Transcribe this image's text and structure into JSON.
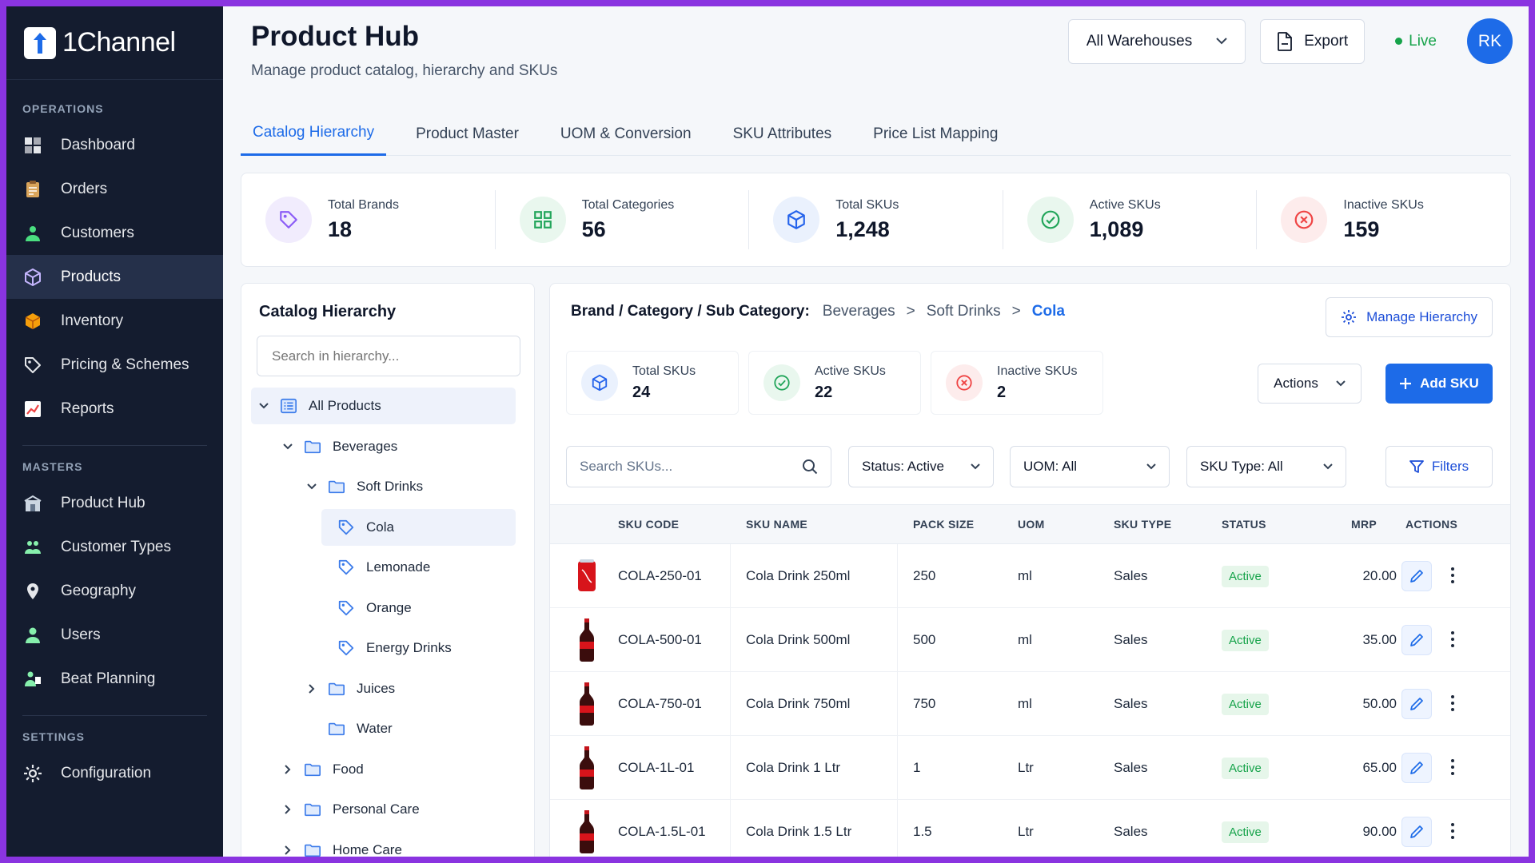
{
  "app": {
    "name": "1Channel"
  },
  "sidebar": {
    "sections": [
      {
        "label": "OPERATIONS",
        "items": [
          {
            "label": "Dashboard",
            "icon": "dashboard-icon",
            "color": "#e5e7eb"
          },
          {
            "label": "Orders",
            "icon": "clipboard-icon",
            "color": "#d9a45b"
          },
          {
            "label": "Customers",
            "icon": "customers-icon",
            "color": "#4ade80"
          },
          {
            "label": "Products",
            "icon": "cube-icon",
            "color": "#c4b5fd",
            "active": true
          },
          {
            "label": "Inventory",
            "icon": "box-icon",
            "color": "#f59e0b"
          },
          {
            "label": "Pricing & Schemes",
            "icon": "tag-icon",
            "color": "#e5e7eb"
          },
          {
            "label": "Reports",
            "icon": "chart-icon",
            "color": "#ef4444"
          }
        ]
      },
      {
        "label": "MASTERS",
        "items": [
          {
            "label": "Product Hub",
            "icon": "product-hub-icon",
            "color": "#cbd5e1"
          },
          {
            "label": "Customer Types",
            "icon": "customer-types-icon",
            "color": "#86efac"
          },
          {
            "label": "Geography",
            "icon": "location-pin-icon",
            "color": "#e5e7eb"
          },
          {
            "label": "Users",
            "icon": "user-icon",
            "color": "#86efac"
          },
          {
            "label": "Beat Planning",
            "icon": "beat-planning-icon",
            "color": "#86efac"
          }
        ]
      },
      {
        "label": "SETTINGS",
        "items": [
          {
            "label": "Configuration",
            "icon": "gear-icon",
            "color": "#e5e7eb"
          }
        ]
      }
    ]
  },
  "header": {
    "title": "Product Hub",
    "subtitle": "Manage product catalog, hierarchy and SKUs",
    "warehouse": "All Warehouses",
    "export": "Export",
    "live": "Live",
    "avatar": "RK"
  },
  "tabs": [
    "Catalog Hierarchy",
    "Product Master",
    "UOM & Conversion",
    "SKU Attributes",
    "Price List Mapping"
  ],
  "stats": [
    {
      "label": "Total Brands",
      "value": "18",
      "icon": "tag-icon",
      "color": "#8b5cf6",
      "bg": "#f1ecfd"
    },
    {
      "label": "Total Categories",
      "value": "56",
      "icon": "grid-icon",
      "color": "#22a55a",
      "bg": "#e9f7ee"
    },
    {
      "label": "Total SKUs",
      "value": "1,248",
      "icon": "cube-icon",
      "color": "#2563eb",
      "bg": "#eaf1fd"
    },
    {
      "label": "Active SKUs",
      "value": "1,089",
      "icon": "check-circle-icon",
      "color": "#22a55a",
      "bg": "#e9f7ee"
    },
    {
      "label": "Inactive SKUs",
      "value": "159",
      "icon": "x-circle-icon",
      "color": "#ef4444",
      "bg": "#fdecec"
    }
  ],
  "hierarchy": {
    "title": "Catalog Hierarchy",
    "search_placeholder": "Search in hierarchy...",
    "nodes": [
      {
        "label": "All Products",
        "level": 0,
        "chevron": "down",
        "icon": "list-icon",
        "selected": true
      },
      {
        "label": "Beverages",
        "level": 1,
        "chevron": "down",
        "icon": "folder-icon"
      },
      {
        "label": "Soft Drinks",
        "level": 2,
        "chevron": "down",
        "icon": "folder-icon"
      },
      {
        "label": "Cola",
        "level": 3,
        "chevron": "none",
        "icon": "tag-icon",
        "selected": true
      },
      {
        "label": "Lemonade",
        "level": 3,
        "chevron": "none",
        "icon": "tag-icon"
      },
      {
        "label": "Orange",
        "level": 3,
        "chevron": "none",
        "icon": "tag-icon"
      },
      {
        "label": "Energy Drinks",
        "level": 3,
        "chevron": "none",
        "icon": "tag-icon"
      },
      {
        "label": "Juices",
        "level": 2,
        "chevron": "right",
        "icon": "folder-icon"
      },
      {
        "label": "Water",
        "level": 2,
        "chevron": "none",
        "icon": "folder-icon"
      },
      {
        "label": "Food",
        "level": 1,
        "chevron": "right",
        "icon": "folder-icon"
      },
      {
        "label": "Personal Care",
        "level": 1,
        "chevron": "right",
        "icon": "folder-icon"
      },
      {
        "label": "Home Care",
        "level": 1,
        "chevron": "right",
        "icon": "folder-icon"
      }
    ]
  },
  "detail": {
    "breadcrumb_label": "Brand / Category / Sub Category:",
    "breadcrumb": [
      "Beverages",
      "Soft Drinks",
      "Cola"
    ],
    "manage": "Manage Hierarchy",
    "mini_stats": [
      {
        "label": "Total SKUs",
        "value": "24",
        "icon": "cube-icon",
        "color": "#2563eb",
        "bg": "#eaf1fd"
      },
      {
        "label": "Active SKUs",
        "value": "22",
        "icon": "check-circle-icon",
        "color": "#22a55a",
        "bg": "#e9f7ee"
      },
      {
        "label": "Inactive SKUs",
        "value": "2",
        "icon": "x-circle-icon",
        "color": "#ef4444",
        "bg": "#fdecec"
      }
    ],
    "actions": "Actions",
    "add_sku": "Add SKU",
    "search_placeholder": "Search SKUs...",
    "status_filter": "Status: Active",
    "uom_filter": "UOM: All",
    "type_filter": "SKU Type: All",
    "filters": "Filters"
  },
  "table": {
    "columns": [
      "SKU CODE",
      "SKU NAME",
      "PACK SIZE",
      "UOM",
      "SKU TYPE",
      "STATUS",
      "MRP",
      "ACTIONS"
    ],
    "rows": [
      {
        "code": "COLA-250-01",
        "name": "Cola Drink 250ml",
        "pack": "250",
        "uom": "ml",
        "type": "Sales",
        "status": "Active",
        "mrp": "20.00",
        "image": "can"
      },
      {
        "code": "COLA-500-01",
        "name": "Cola Drink 500ml",
        "pack": "500",
        "uom": "ml",
        "type": "Sales",
        "status": "Active",
        "mrp": "35.00",
        "image": "bottle"
      },
      {
        "code": "COLA-750-01",
        "name": "Cola Drink 750ml",
        "pack": "750",
        "uom": "ml",
        "type": "Sales",
        "status": "Active",
        "mrp": "50.00",
        "image": "bottle"
      },
      {
        "code": "COLA-1L-01",
        "name": "Cola Drink 1 Ltr",
        "pack": "1",
        "uom": "Ltr",
        "type": "Sales",
        "status": "Active",
        "mrp": "65.00",
        "image": "bottle"
      },
      {
        "code": "COLA-1.5L-01",
        "name": "Cola Drink 1.5 Ltr",
        "pack": "1.5",
        "uom": "Ltr",
        "type": "Sales",
        "status": "Active",
        "mrp": "90.00",
        "image": "bottle"
      }
    ]
  }
}
